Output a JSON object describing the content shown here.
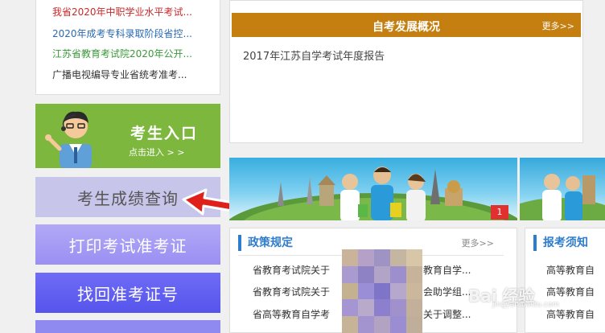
{
  "news": {
    "items": [
      {
        "text": "我省2020年中职学业水平考试...",
        "color": "#cc2a2a"
      },
      {
        "text": "2020年成考专科录取阶段省控...",
        "color": "#2a6ab4"
      },
      {
        "text": "江苏省教育考试院2020年公开...",
        "color": "#3a9a3a"
      },
      {
        "text": "广播电视编导专业省统考准考...",
        "color": "#333333"
      }
    ]
  },
  "student_entry": {
    "title": "考生入口",
    "subtitle": "点击进入 > >"
  },
  "side_buttons": {
    "score": "考生成绩查询",
    "print": "打印考试准考证",
    "find": "找回准考证号"
  },
  "overview": {
    "title": "自考发展概况",
    "more": "更多>>",
    "items": [
      "2017年江苏自学考试年度报告"
    ]
  },
  "banner": {
    "badge": "1"
  },
  "policy": {
    "title": "政策规定",
    "more": "更多>>",
    "items_left": [
      "省教育考试院关于",
      "省教育考试院关于",
      "省高等教育自学考"
    ],
    "items_right": [
      "教育自学...",
      "会助学组...",
      "关于调整..."
    ]
  },
  "notice": {
    "title": "报考须知",
    "items": [
      "高等教育自",
      "高等教育自",
      "高等教育自"
    ]
  },
  "watermark": {
    "main": "Bai 经验",
    "sub": "jingyan.baidu.com"
  },
  "colors": {
    "brand_orange": "#c47f10",
    "entry_green": "#7db73d",
    "link_blue": "#2e7ccc",
    "arrow_red": "#e0201a"
  }
}
